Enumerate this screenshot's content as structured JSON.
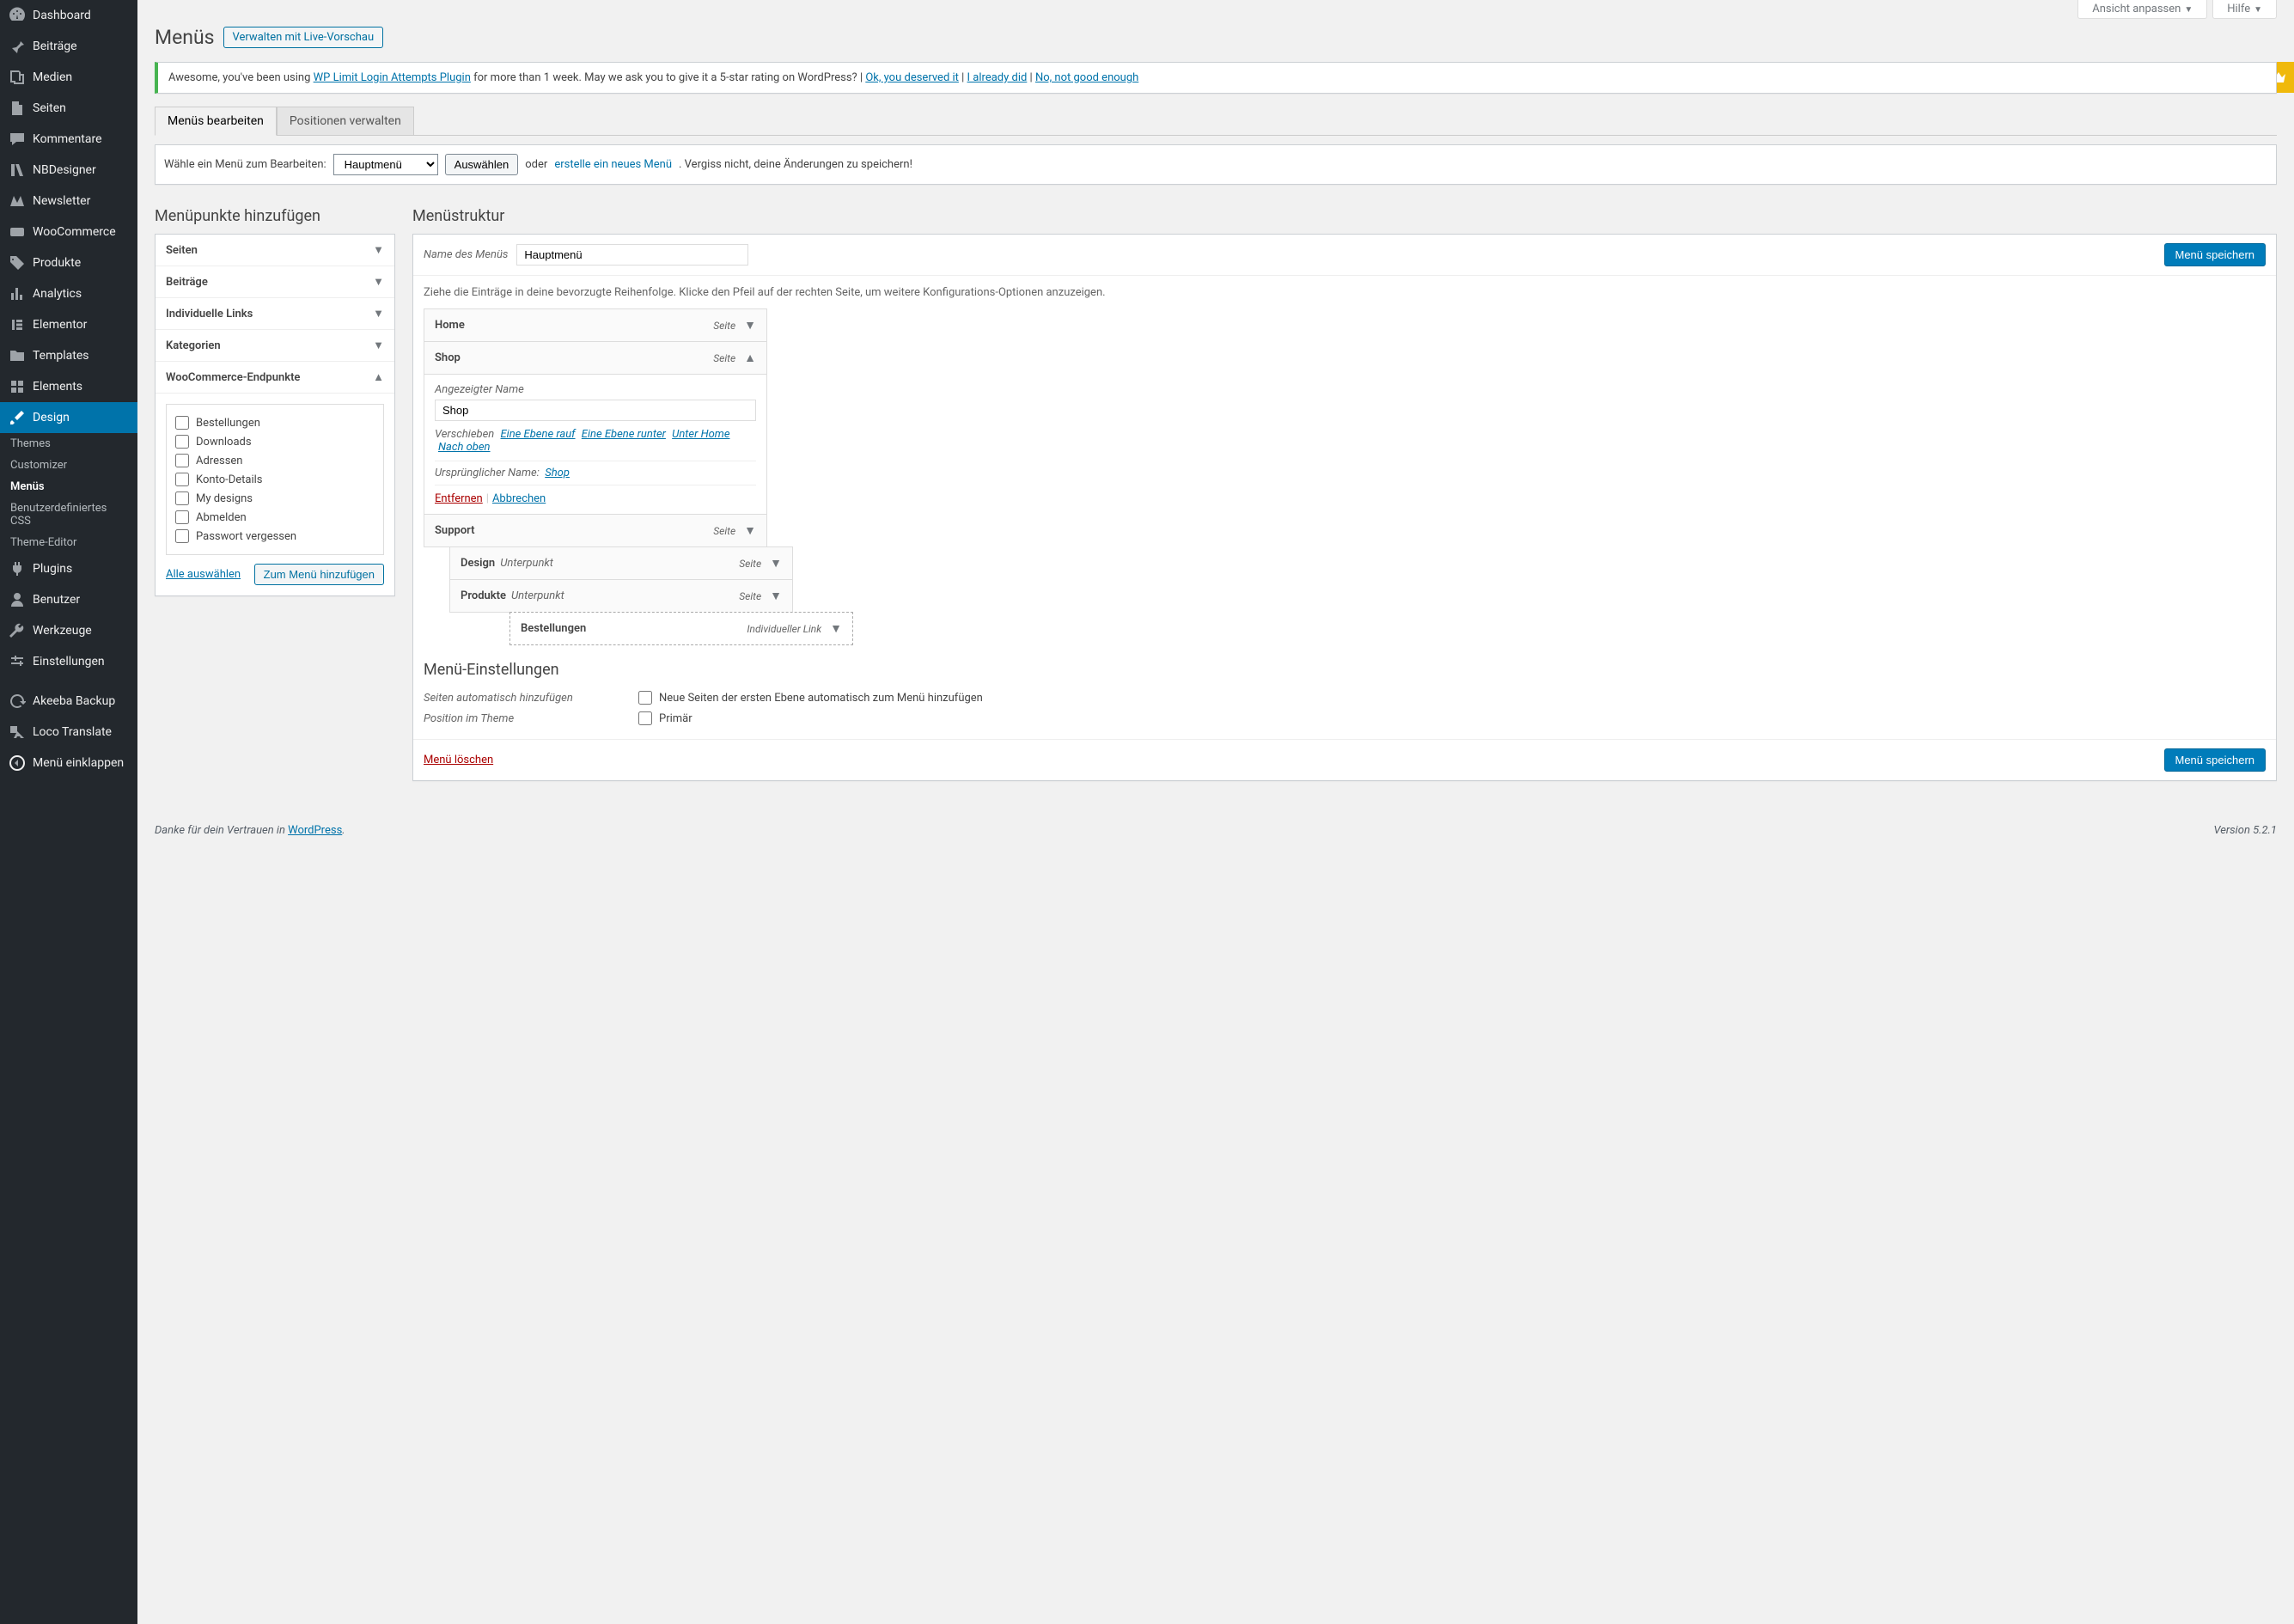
{
  "screen_meta": {
    "customize": "Ansicht anpassen",
    "help": "Hilfe"
  },
  "sidebar": {
    "items": [
      {
        "label": "Dashboard"
      },
      {
        "label": "Beiträge"
      },
      {
        "label": "Medien"
      },
      {
        "label": "Seiten"
      },
      {
        "label": "Kommentare"
      },
      {
        "label": "NBDesigner"
      },
      {
        "label": "Newsletter"
      },
      {
        "label": "WooCommerce"
      },
      {
        "label": "Produkte"
      },
      {
        "label": "Analytics"
      },
      {
        "label": "Elementor"
      },
      {
        "label": "Templates"
      },
      {
        "label": "Elements"
      },
      {
        "label": "Design"
      },
      {
        "label": "Plugins"
      },
      {
        "label": "Benutzer"
      },
      {
        "label": "Werkzeuge"
      },
      {
        "label": "Einstellungen"
      },
      {
        "label": "Akeeba Backup"
      },
      {
        "label": "Loco Translate"
      },
      {
        "label": "Menü einklappen"
      }
    ],
    "submenu": [
      {
        "label": "Themes"
      },
      {
        "label": "Customizer"
      },
      {
        "label": "Menüs"
      },
      {
        "label": "Benutzerdefiniertes CSS"
      },
      {
        "label": "Theme-Editor"
      }
    ]
  },
  "page": {
    "title": "Menüs",
    "title_action": "Verwalten mit Live-Vorschau"
  },
  "notice": {
    "pre": "Awesome, you've been using ",
    "plugin": "WP Limit Login Attempts Plugin",
    "mid": " for more than 1 week. May we ask you to give it a 5-star rating on WordPress? | ",
    "ok": "Ok, you deserved it",
    "sep": " | ",
    "already": "I already did",
    "no": "No, not good enough"
  },
  "tabs": {
    "edit": "Menüs bearbeiten",
    "locations": "Positionen verwalten"
  },
  "manage": {
    "label": "Wähle ein Menü zum Bearbeiten:",
    "selected": "Hauptmenü",
    "select_btn": "Auswählen",
    "or": "oder",
    "create": "erstelle ein neues Menü",
    "hint": ". Vergiss nicht, deine Änderungen zu speichern!"
  },
  "left": {
    "heading": "Menüpunkte hinzufügen",
    "sections": {
      "pages": "Seiten",
      "posts": "Beiträge",
      "links": "Individuelle Links",
      "cats": "Kategorien",
      "woo": "WooCommerce-Endpunkte"
    },
    "woo_items": [
      "Bestellungen",
      "Downloads",
      "Adressen",
      "Konto-Details",
      "My designs",
      "Abmelden",
      "Passwort vergessen"
    ],
    "select_all": "Alle auswählen",
    "add_btn": "Zum Menü hinzufügen"
  },
  "structure": {
    "heading": "Menüstruktur",
    "name_label": "Name des Menüs",
    "name_value": "Hauptmenü",
    "save": "Menü speichern",
    "instructions": "Ziehe die Einträge in deine bevorzugte Reihenfolge. Klicke den Pfeil auf der rechten Seite, um weitere Konfigurations-Optionen anzuzeigen.",
    "type_page": "Seite",
    "type_custom": "Individueller Link",
    "sub_label": "Unterpunkt",
    "items": {
      "home": "Home",
      "shop": "Shop",
      "support": "Support",
      "design": "Design",
      "produkte": "Produkte",
      "bestellungen": "Bestellungen"
    },
    "shop_settings": {
      "display_label": "Angezeigter Name",
      "display_value": "Shop",
      "move_label": "Verschieben",
      "up": "Eine Ebene rauf",
      "down": "Eine Ebene runter",
      "under": "Unter Home",
      "top": "Nach oben",
      "orig_label": "Ursprünglicher Name:",
      "orig_link": "Shop",
      "remove": "Entfernen",
      "cancel": "Abbrechen"
    }
  },
  "settings": {
    "heading": "Menü-Einstellungen",
    "auto_label": "Seiten automatisch hinzufügen",
    "auto_desc": "Neue Seiten der ersten Ebene automatisch zum Menü hinzufügen",
    "pos_label": "Position im Theme",
    "pos_desc": "Primär"
  },
  "delete_menu": "Menü löschen",
  "footer": {
    "thanks_pre": "Danke für dein Vertrauen in ",
    "wp": "WordPress",
    "version": "Version 5.2.1"
  }
}
